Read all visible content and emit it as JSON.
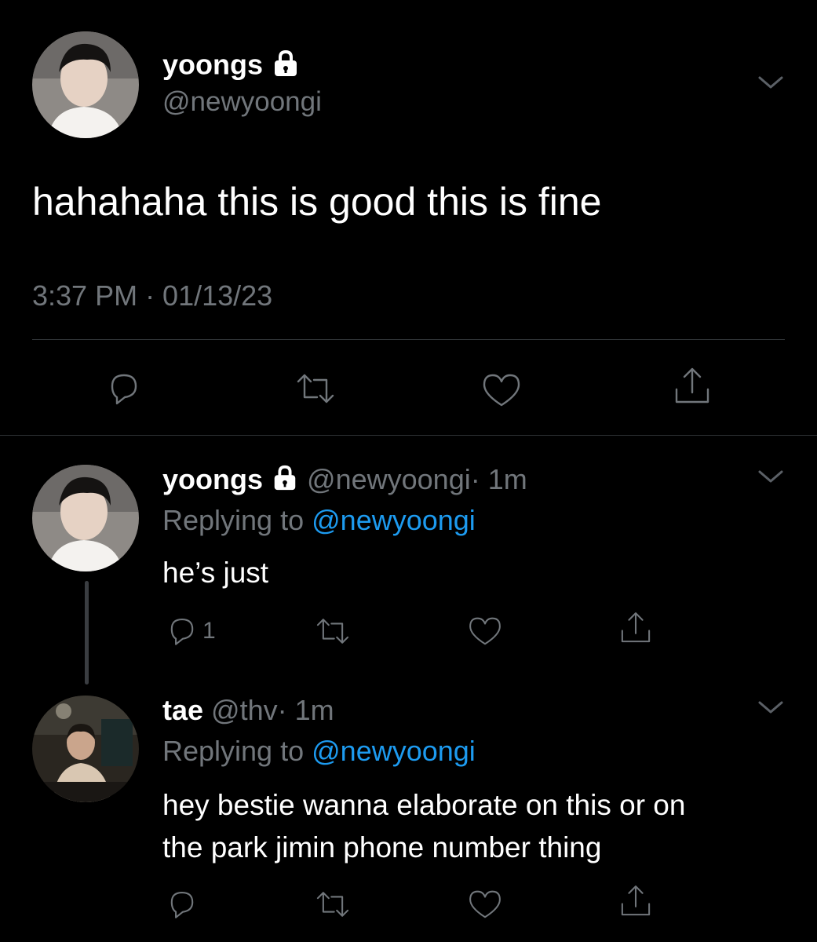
{
  "main_tweet": {
    "display_name": "yoongs",
    "handle": "@newyoongi",
    "text": "hahahaha this is good this is fine",
    "timestamp": "3:37 PM · 01/13/23",
    "protected_icon": "lock-icon",
    "menu_icon": "chevron-down-icon"
  },
  "replies": [
    {
      "display_name": "yoongs",
      "handle": "@newyoongi",
      "time": "· 1m",
      "replying_label": "Replying to",
      "replying_to": "@newyoongi",
      "text": "he’s just",
      "reply_count": "1"
    },
    {
      "display_name": "tae",
      "handle": "@thv",
      "time": "· 1m",
      "replying_label": "Replying to",
      "replying_to": "@newyoongi",
      "text_line1": "hey bestie wanna elaborate on this or on",
      "text_line2": "the park jimin phone number thing"
    }
  ],
  "icons": [
    "reply-icon",
    "retweet-icon",
    "like-icon",
    "share-icon"
  ],
  "colors": {
    "background": "#000000",
    "muted": "#71767b",
    "link": "#1d9bf0",
    "divider": "#2f3336"
  }
}
